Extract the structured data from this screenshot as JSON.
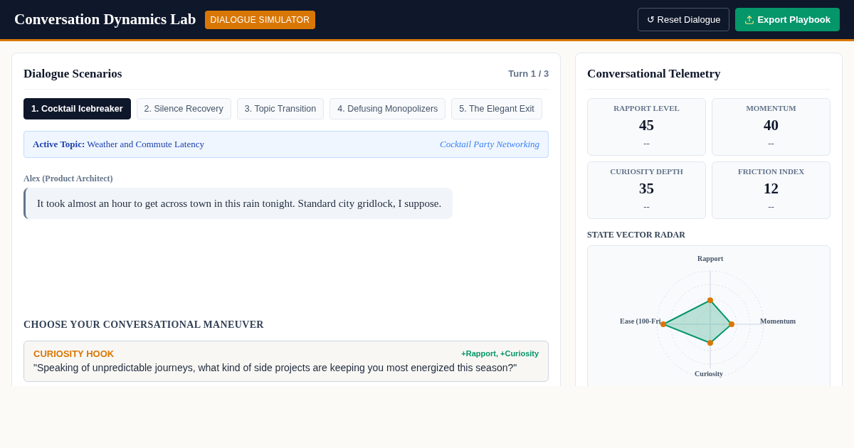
{
  "header": {
    "title": "Conversation Dynamics Lab",
    "badge": "DIALOGUE SIMULATOR",
    "buttons": [
      {
        "kind": "outline",
        "icon": "↺",
        "label": "Reset Dialogue"
      },
      {
        "kind": "primary",
        "label": "Export Playbook"
      }
    ]
  },
  "scenarios": {
    "title": "Dialogue Scenarios",
    "turn": "Turn 1 / 3",
    "tabs": [
      {
        "label": "1. Cocktail Icebreaker",
        "selected": true
      },
      {
        "label": "2. Silence Recovery",
        "selected": false
      },
      {
        "label": "3. Topic Transition",
        "selected": false
      },
      {
        "label": "4. Defusing Monopolizers",
        "selected": false
      },
      {
        "label": "5. The Elegant Exit",
        "selected": false
      }
    ],
    "topic": {
      "text": "**Active Topic:** Weather and Commute Latency",
      "setting": "Cocktail Party Networking"
    },
    "messages": [
      {
        "speaker": "Alex (Product Architect)",
        "text": "It took almost an hour to get across town in this rain tonight. Standard city gridlock, I suppose."
      }
    ],
    "maneuver_heading": "CHOOSE YOUR CONVERSATIONAL MANEUVER",
    "options": [
      {
        "name": "CURIOSITY HOOK",
        "effect": "+Rapport, +Curiosity",
        "text": "\"Speaking of unpredictable journeys, what kind of side projects are keeping you most energized this season?\""
      }
    ]
  },
  "telemetry": {
    "title": "Conversational Telemetry",
    "metrics": [
      {
        "label": "RAPPORT LEVEL",
        "value": "45",
        "delta": "--"
      },
      {
        "label": "MOMENTUM",
        "value": "40",
        "delta": "--"
      },
      {
        "label": "CURIOSITY DEPTH",
        "value": "35",
        "delta": "--"
      },
      {
        "label": "FRICTION INDEX",
        "value": "12",
        "delta": "--"
      }
    ],
    "radar": {
      "title": "STATE VECTOR RADAR",
      "axes": [
        "Rapport",
        "Momentum",
        "Curiosity",
        "Ease (100-Fri"
      ]
    }
  }
}
